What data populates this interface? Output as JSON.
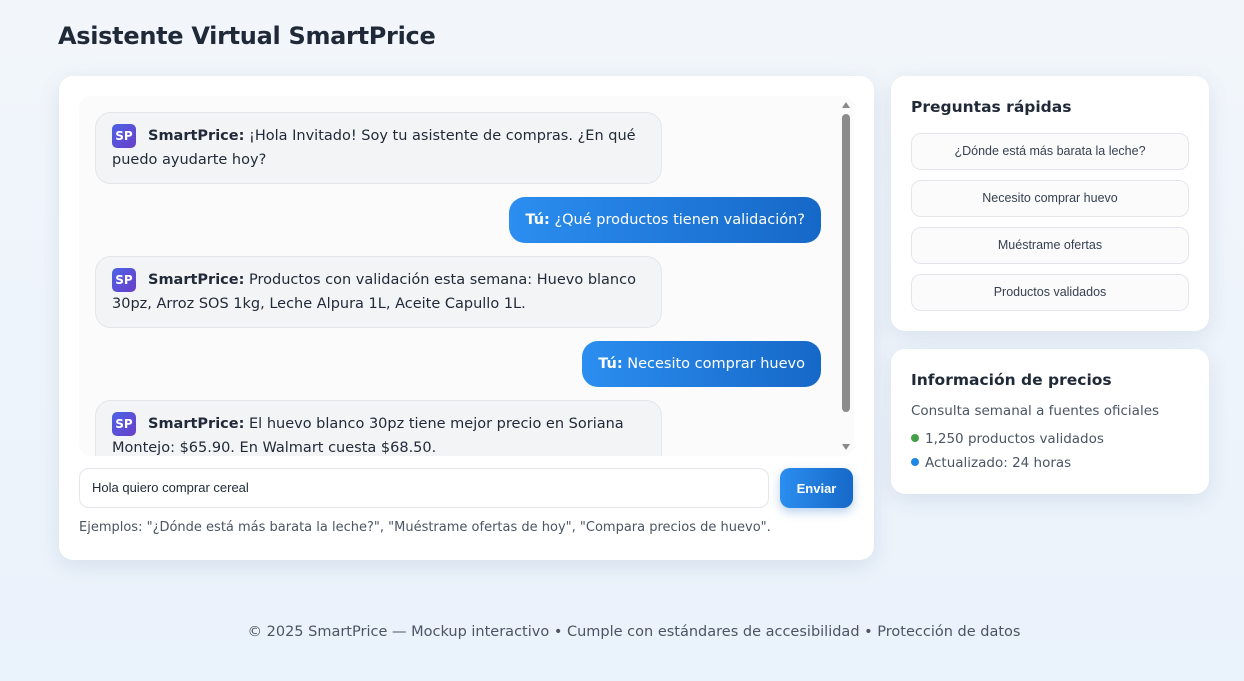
{
  "page": {
    "title": "Asistente Virtual SmartPrice"
  },
  "chat": {
    "messages": [
      {
        "role": "bot",
        "logo": "SP",
        "sender": "SmartPrice:",
        "text": "¡Hola Invitado! Soy tu asistente de compras. ¿En qué puedo ayudarte hoy?"
      },
      {
        "role": "user",
        "sender": "Tú:",
        "text": "¿Qué productos tienen validación?"
      },
      {
        "role": "bot",
        "logo": "SP",
        "sender": "SmartPrice:",
        "text": "Productos con validación esta semana: Huevo blanco 30pz, Arroz SOS 1kg, Leche Alpura 1L, Aceite Capullo 1L."
      },
      {
        "role": "user",
        "sender": "Tú:",
        "text": "Necesito comprar huevo"
      },
      {
        "role": "bot",
        "logo": "SP",
        "sender": "SmartPrice:",
        "text": "El huevo blanco 30pz tiene mejor precio en Soriana Montejo: $65.90. En Walmart cuesta $68.50."
      }
    ],
    "input_value": "Hola quiero comprar cereal",
    "send_label": "Enviar",
    "examples": "Ejemplos: \"¿Dónde está más barata la leche?\", \"Muéstrame ofertas de hoy\", \"Compara precios de huevo\"."
  },
  "quick": {
    "title": "Preguntas rápidas",
    "items": [
      "¿Dónde está más barata la leche?",
      "Necesito comprar huevo",
      "Muéstrame ofertas",
      "Productos validados"
    ]
  },
  "info": {
    "title": "Información de precios",
    "subtitle": "Consulta semanal a fuentes oficiales",
    "stats": [
      {
        "text": "1,250 productos validados",
        "color": "#43a047"
      },
      {
        "text": "Actualizado: 24 horas",
        "color": "#1e88e5"
      }
    ]
  },
  "footer": {
    "text": "© 2025 SmartPrice — Mockup interactivo • Cumple con estándares de accesibilidad • Protección de datos"
  },
  "colors": {
    "accent": "#1e7be0",
    "accent_dark": "#1668c7",
    "logo": "#5a4fd8"
  }
}
